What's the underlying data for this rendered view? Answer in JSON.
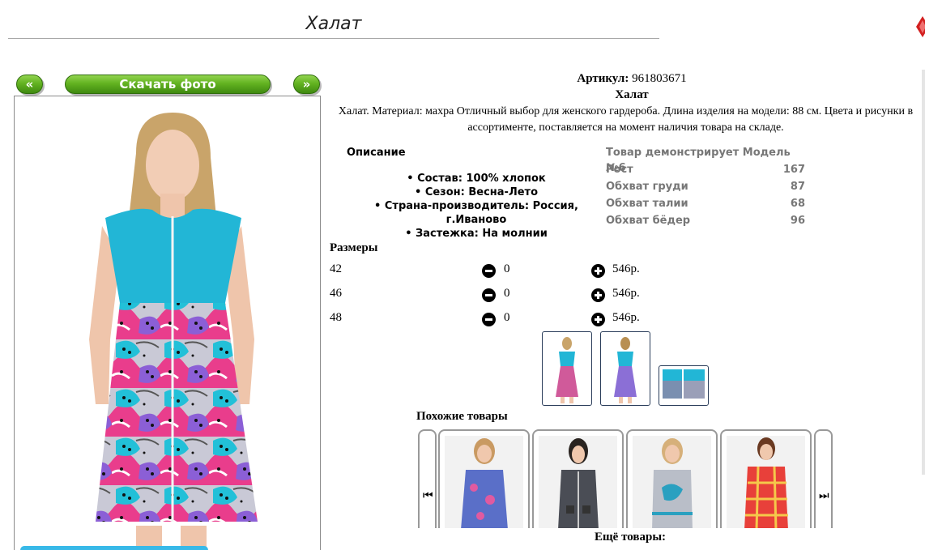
{
  "page": {
    "title": "Халат"
  },
  "nav": {
    "prev_label": "«",
    "download_label": "Скачать фото",
    "next_label": "»"
  },
  "product": {
    "article_label": "Артикул:",
    "article_value": "961803671",
    "name": "Халат",
    "description": "Халат. Материал: махра Отличный выбор для женского гардероба. Длина изделия на модели: 88 см. Цвета и рисунки в ассортименте, поставляется на момент наличия товара на складе.",
    "details_heading": "Описание",
    "details": [
      "Состав: 100% хлопок",
      "Сезон: Весна-Лето",
      "Страна-производитель: Россия, г.Иваново",
      "Застежка: На молнии"
    ]
  },
  "model": {
    "rows": [
      {
        "label": "Товар демонстрирует Модель №6",
        "value": ""
      },
      {
        "label": "Рост",
        "value": "167"
      },
      {
        "label": "Обхват груди",
        "value": "87"
      },
      {
        "label": "Обхват талии",
        "value": "68"
      },
      {
        "label": "Обхват бёдер",
        "value": "96"
      }
    ]
  },
  "sizes": {
    "heading": "Размеры",
    "rows": [
      {
        "size": "42",
        "qty": "0",
        "price": "546р."
      },
      {
        "size": "46",
        "qty": "0",
        "price": "546р."
      },
      {
        "size": "48",
        "qty": "0",
        "price": "546р."
      }
    ]
  },
  "icons": {
    "decrease": "minus-circle-icon",
    "increase": "plus-circle-icon",
    "carousel_prev": "skip-back-icon",
    "carousel_next": "skip-forward-icon"
  },
  "similar": {
    "heading": "Похожие товары",
    "prev_glyph": "⏮",
    "next_glyph": "⏭"
  },
  "more": {
    "heading": "Ещё товары:"
  },
  "colors": {
    "button_green": "#63b321",
    "dress_turquoise": "#22b6d6",
    "print_pink": "#e93d8c",
    "print_purple": "#8b5fd6"
  }
}
